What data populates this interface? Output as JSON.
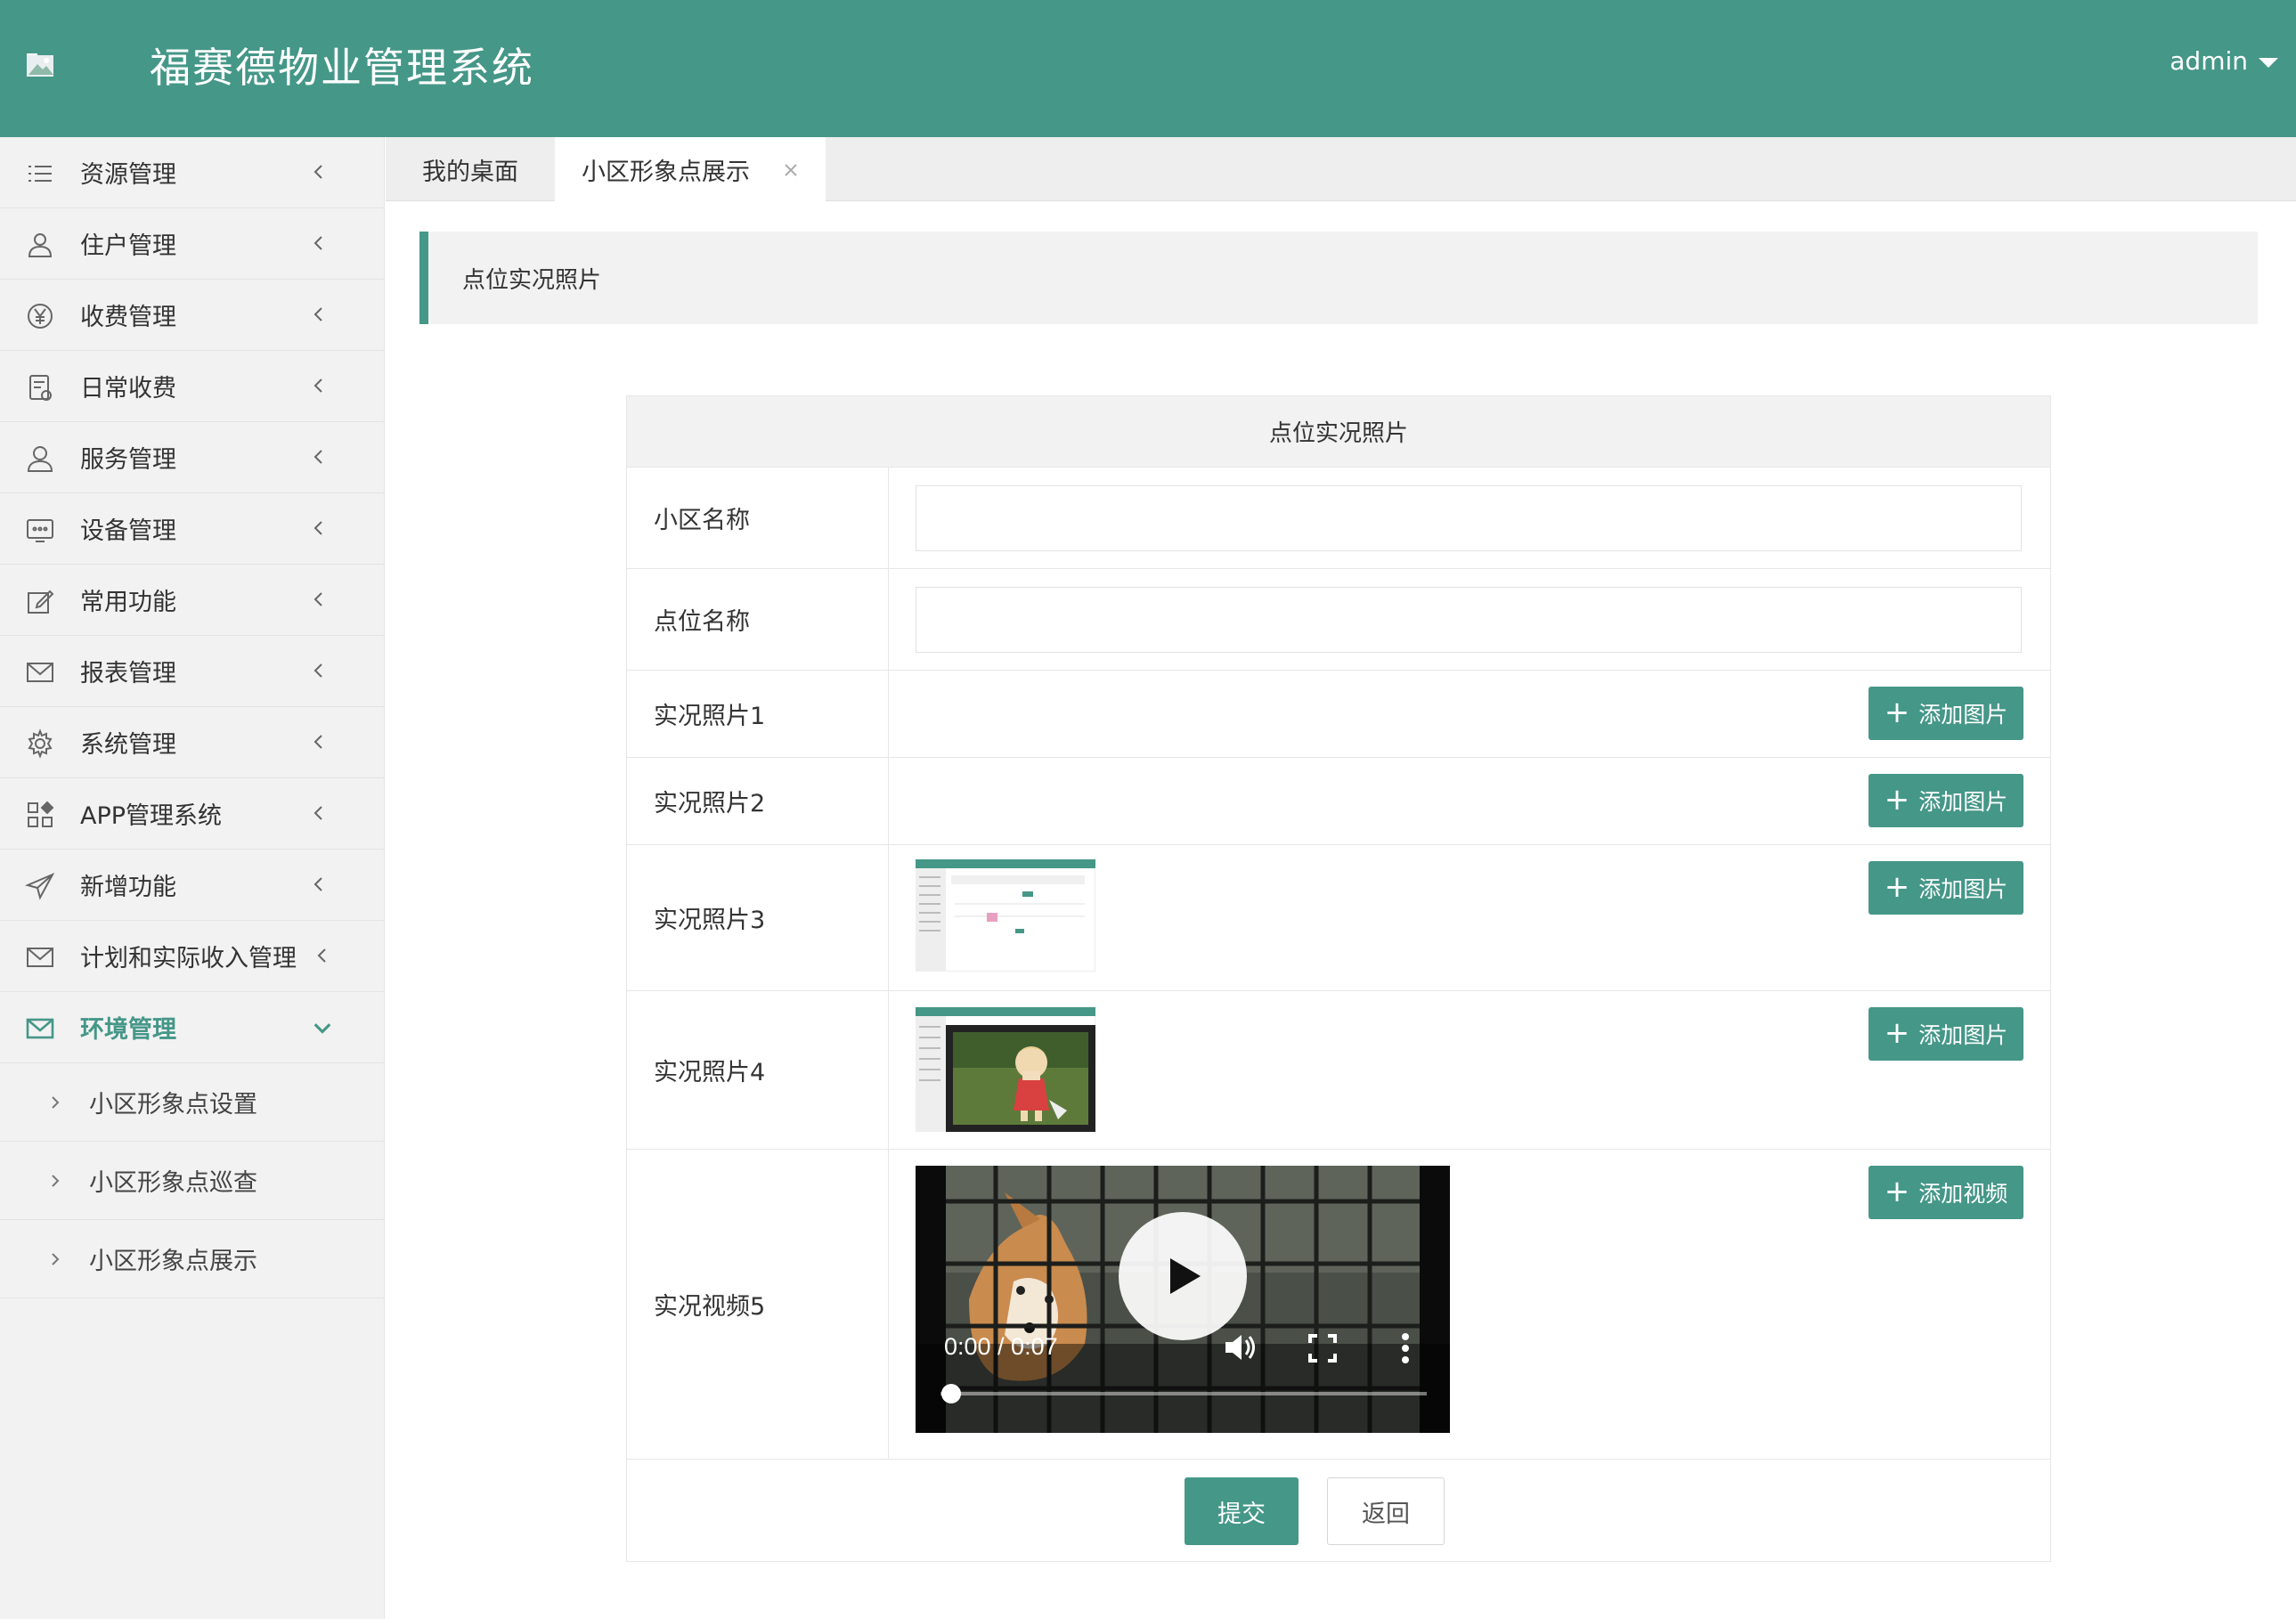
{
  "header": {
    "title": "福赛德物业管理系统",
    "user": "admin"
  },
  "sidebar": {
    "items": [
      {
        "label": "资源管理",
        "icon": "list-icon"
      },
      {
        "label": "住户管理",
        "icon": "user-icon"
      },
      {
        "label": "收费管理",
        "icon": "yen-icon"
      },
      {
        "label": "日常收费",
        "icon": "bill-icon"
      },
      {
        "label": "服务管理",
        "icon": "person-icon"
      },
      {
        "label": "设备管理",
        "icon": "device-icon"
      },
      {
        "label": "常用功能",
        "icon": "edit-icon"
      },
      {
        "label": "报表管理",
        "icon": "mail-icon"
      },
      {
        "label": "系统管理",
        "icon": "gear-icon"
      },
      {
        "label": "APP管理系统",
        "icon": "apps-icon"
      },
      {
        "label": "新增功能",
        "icon": "send-icon"
      },
      {
        "label": "计划和实际收入管理",
        "icon": "mail-icon"
      },
      {
        "label": "环境管理",
        "icon": "mail-icon"
      }
    ],
    "subitems": [
      {
        "label": "小区形象点设置"
      },
      {
        "label": "小区形象点巡查"
      },
      {
        "label": "小区形象点展示"
      }
    ]
  },
  "tabs": {
    "home": "我的桌面",
    "active": "小区形象点展示"
  },
  "notice": "点位实况照片",
  "form": {
    "title": "点位实况照片",
    "fields": {
      "community": {
        "label": "小区名称",
        "value": ""
      },
      "point": {
        "label": "点位名称",
        "value": ""
      }
    },
    "photos": [
      {
        "label": "实况照片1"
      },
      {
        "label": "实况照片2"
      },
      {
        "label": "实况照片3"
      },
      {
        "label": "实况照片4"
      }
    ],
    "video": {
      "label": "实况视频5",
      "time": "0:00 / 0:07",
      "progress": 0.0
    },
    "add_photo_label": "添加图片",
    "add_video_label": "添加视频",
    "submit_label": "提交",
    "back_label": "返回"
  },
  "colors": {
    "brand": "#459788",
    "sidebar_bg": "#f2f2f2"
  }
}
